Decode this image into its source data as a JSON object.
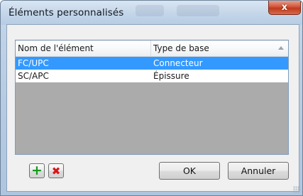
{
  "window": {
    "title": "Éléments personnalisés",
    "close_label": "x"
  },
  "list": {
    "columns": [
      "Nom de l'élément",
      "Type de base"
    ],
    "rows": [
      {
        "name": "FC/UPC",
        "type": "Connecteur",
        "selected": true
      },
      {
        "name": "SC/APC",
        "type": "Épissure",
        "selected": false
      }
    ]
  },
  "footer": {
    "add_icon": "plus-icon",
    "delete_icon": "delete-x-icon",
    "ok_label": "OK",
    "cancel_label": "Annuler"
  },
  "colors": {
    "selection": "#3399ff",
    "add": "#159a1d",
    "delete": "#d9141b"
  }
}
